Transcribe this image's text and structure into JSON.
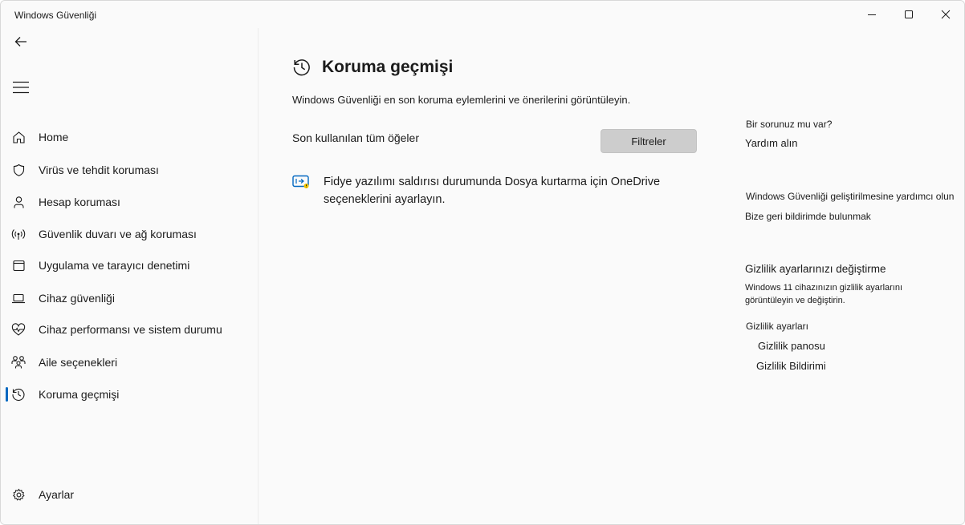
{
  "window": {
    "title": "Windows Güvenliği",
    "controls": {
      "minimize": "minimize-icon",
      "maximize": "maximize-icon",
      "close": "close-icon"
    }
  },
  "sidebar": {
    "back_icon": "back-arrow-icon",
    "menu_icon": "hamburger-menu-icon",
    "items": [
      {
        "label": "Home",
        "icon": "home-icon"
      },
      {
        "label": "Virüs ve tehdit koruması",
        "icon": "shield-icon"
      },
      {
        "label": "Hesap koruması",
        "icon": "person-icon"
      },
      {
        "label": "Güvenlik duvarı ve ağ koruması",
        "icon": "wifi-signal-icon"
      },
      {
        "label": "Uygulama ve tarayıcı denetimi",
        "icon": "browser-window-icon"
      },
      {
        "label": "Cihaz güvenliği",
        "icon": "laptop-icon"
      },
      {
        "label": "Cihaz performansı ve sistem durumu",
        "icon": "heartbeat-icon"
      },
      {
        "label": "Aile seçenekleri",
        "icon": "family-icon"
      },
      {
        "label": "Koruma geçmişi",
        "icon": "history-icon",
        "active": true
      }
    ],
    "settings": {
      "label": "Ayarlar",
      "icon": "gear-icon"
    }
  },
  "main": {
    "title": "Koruma geçmişi",
    "subtitle": "Windows Güvenliği en son koruma eylemlerini ve önerilerini görüntüleyin.",
    "list_label": "Son kullanılan tüm öğeler",
    "filter_button": "Filtreler",
    "recommendation": "Fidye yazılımı saldırısı durumunda Dosya kurtarma için OneDrive seçeneklerini ayarlayın."
  },
  "right_panel": {
    "question": "Bir sorunuz mu var?",
    "help_link": "Yardım alın",
    "improve_heading": "Windows Güvenliği geliştirilmesine yardımcı olun",
    "feedback_link": "Bize geri bildirimde bulunmak",
    "privacy_title": "Gizlilik ayarlarınızı değiştirme",
    "privacy_desc": "Windows 11 cihazınızın gizlilik ayarlarını görüntüleyin ve değiştirin.",
    "privacy_settings_link": "Gizlilik ayarları",
    "privacy_dashboard_link": "Gizlilik panosu",
    "privacy_notice_link": "Gizlilik Bildirimi"
  },
  "colors": {
    "accent": "#0067c0",
    "background": "#fafafa",
    "filter_button": "#cdcdcd"
  }
}
